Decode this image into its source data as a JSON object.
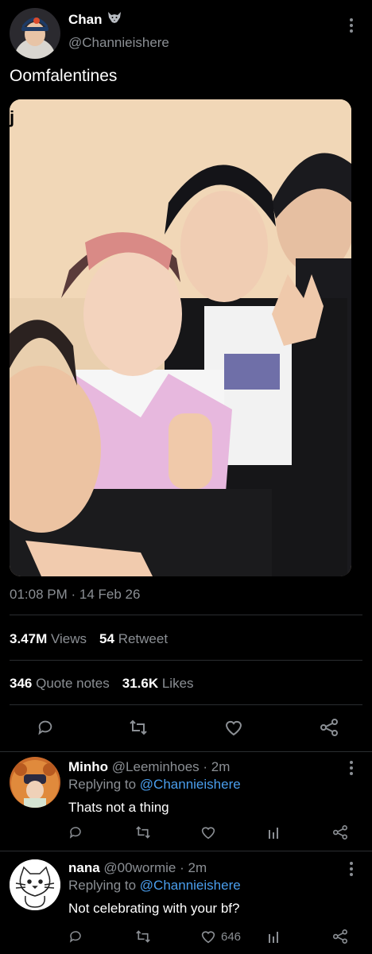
{
  "tweet": {
    "display_name": "Chan",
    "name_emoji_icon": "wolf-icon",
    "handle": "@Channieishere",
    "text": "Oomfalentines",
    "photo_corner_letter": "j",
    "timestamp": "01:08 PM · 14 Feb 26",
    "views_value": "3.47M",
    "views_label": "Views",
    "retweets_value": "54",
    "retweets_label": "Retweet",
    "quotes_value": "346",
    "quotes_label": "Quote notes",
    "likes_value": "31.6K",
    "likes_label": "Likes"
  },
  "replies": [
    {
      "display_name": "Minho",
      "handle": "@Leeminhoes",
      "time": "· 2m",
      "replying_label": "Replying to",
      "replying_to": "@Channieishere",
      "text": "Thats not a thing",
      "like_count": ""
    },
    {
      "display_name": "nana",
      "handle": "@00wormie",
      "time": "· 2m",
      "replying_label": "Replying to",
      "replying_to": "@Channieishere",
      "text": "Not celebrating with your bf?",
      "like_count": "646"
    }
  ],
  "colors": {
    "background": "#000000",
    "text": "#e7e9ea",
    "muted": "#8b8f94",
    "link": "#4a9eed",
    "divider": "#2a2d30"
  }
}
